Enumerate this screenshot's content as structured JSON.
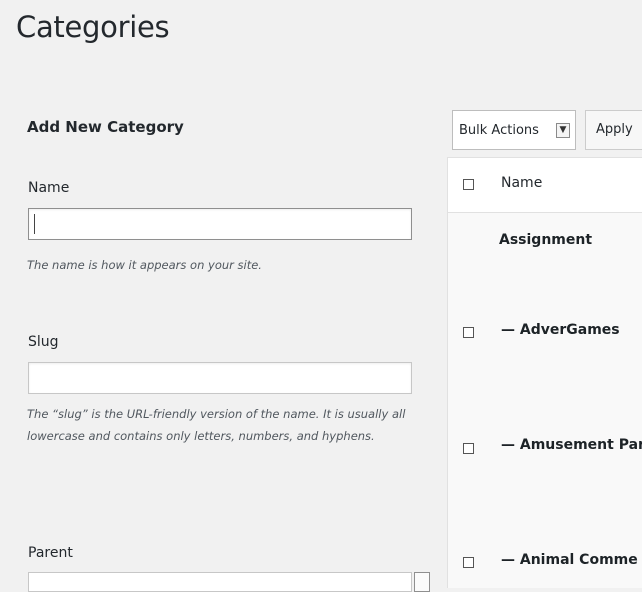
{
  "page": {
    "title": "Categories"
  },
  "form": {
    "title": "Add New Category",
    "name": {
      "label": "Name",
      "value": "",
      "hint": "The name is how it appears on your site."
    },
    "slug": {
      "label": "Slug",
      "value": "",
      "hint": "The “slug” is the URL-friendly version of the name. It is usually all lowercase and contains only letters, numbers, and hyphens."
    },
    "parent": {
      "label": "Parent"
    }
  },
  "toolbar": {
    "bulk_actions": "Bulk Actions",
    "apply": "Apply"
  },
  "table": {
    "column_name": "Name",
    "rows": [
      {
        "name": "Assignment",
        "has_checkbox": false
      },
      {
        "name": "— AdverGames",
        "has_checkbox": true
      },
      {
        "name": "— Amusement Par",
        "has_checkbox": true
      },
      {
        "name": "— Animal Comme",
        "has_checkbox": true
      }
    ]
  }
}
